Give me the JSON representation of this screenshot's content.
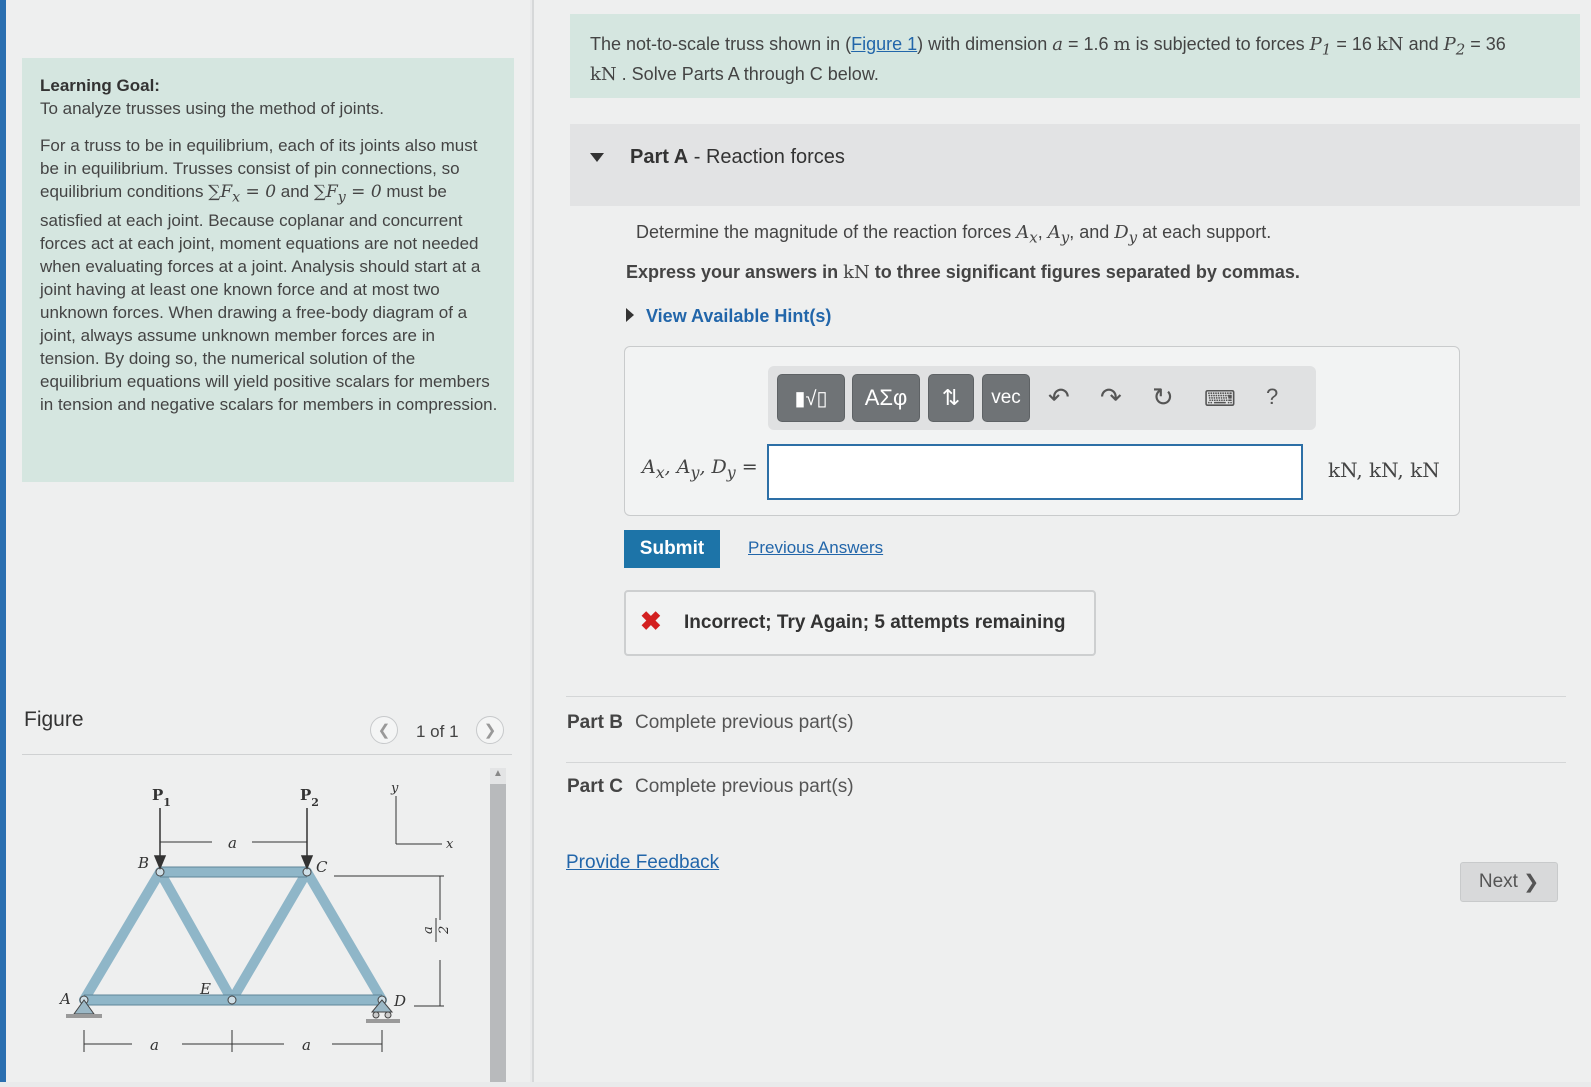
{
  "learning_goal": {
    "title": "Learning Goal:",
    "subtitle": "To analyze trusses using the method of joints.",
    "body_part1": "For a truss to be in equilibrium, each of its joints also must be in equilibrium. Trusses consist of pin connections, so equilibrium conditions",
    "eq1": "∑F",
    "eq1_sub": "x",
    "eq1_rhs": " = 0",
    "and_word": " and",
    "eq2": "∑F",
    "eq2_sub": "y",
    "eq2_rhs": " = 0",
    "body_part2": " must be satisfied at each joint. Because coplanar and concurrent forces act at each joint, moment equations are not needed when evaluating forces at a joint. Analysis should start at a joint having at least one known force and at most two unknown forces. When drawing a free-body diagram of a joint, always assume unknown member forces are in tension. By doing so, the numerical solution of the equilibrium equations will yield positive scalars for members in tension and negative scalars for members in compression."
  },
  "figure": {
    "label": "Figure",
    "counter": "1 of 1",
    "prev_icon": "chevron-left-icon",
    "next_icon": "chevron-right-icon",
    "labels": {
      "P1": "P",
      "P1_sub": "1",
      "P2": "P",
      "P2_sub": "2",
      "a": "a",
      "B": "B",
      "C": "C",
      "E": "E",
      "A": "A",
      "D": "D",
      "x": "x",
      "y": "y",
      "a_half_num": "a",
      "a_half_den": "2"
    }
  },
  "problem": {
    "text1": "The not-to-scale truss shown in (",
    "figure_link": "Figure 1",
    "text2": ") with dimension ",
    "a_var": "a",
    "text3": " = 1.6  ",
    "unit_m": "m",
    "text4": " is subjected to forces ",
    "p1": "P",
    "p1_sub": "1",
    "text5": " = 16  ",
    "kN1": "kN",
    "text6": " and ",
    "p2": "P",
    "p2_sub": "2",
    "text7": " = 36",
    "kN2": "kN",
    "text8": " . Solve Parts A through C below."
  },
  "part_a": {
    "label": "Part A",
    "title": " - Reaction forces",
    "determine_1": "Determine the magnitude of the reaction forces ",
    "Ax": "A",
    "Ax_sub": "x",
    "sep1": ", ",
    "Ay": "A",
    "Ay_sub": "y",
    "sep2": ", and ",
    "Dy": "D",
    "Dy_sub": "y",
    "determine_2": " at each support.",
    "express_1": "Express your answers in ",
    "express_unit": "kN",
    "express_2": " to three significant figures separated by commas.",
    "hint": "View Available Hint(s)",
    "answer_label": "A",
    "answer_label_x": "x",
    "answer_label_sep1": ", A",
    "answer_label_y": "y",
    "answer_label_sep2": ", D",
    "answer_label_dy": "y",
    "answer_label_eq": " =",
    "answer_value": "",
    "answer_placeholder": "",
    "units": "kN, kN, kN",
    "toolbar": {
      "templates": "▮√▯",
      "greek": "ΑΣφ",
      "arrows": "⇅",
      "vec": "vec",
      "undo_icon": "undo-icon",
      "redo_icon": "redo-icon",
      "reset_icon": "reset-icon",
      "keyboard_icon": "keyboard-icon",
      "help": "?"
    },
    "submit": "Submit",
    "previous_answers": "Previous Answers",
    "feedback": "Incorrect; Try Again; 5 attempts remaining"
  },
  "part_b": {
    "label": "Part B",
    "status": "Complete previous part(s)"
  },
  "part_c": {
    "label": "Part C",
    "status": "Complete previous part(s)"
  },
  "provide_feedback": "Provide Feedback",
  "next_button": "Next",
  "colors": {
    "accent_blue": "#1d74a8",
    "link_blue": "#2266aa",
    "goal_bg": "#d5e6e0",
    "error_red": "#d32020",
    "truss_member": "#8fb6c8"
  }
}
